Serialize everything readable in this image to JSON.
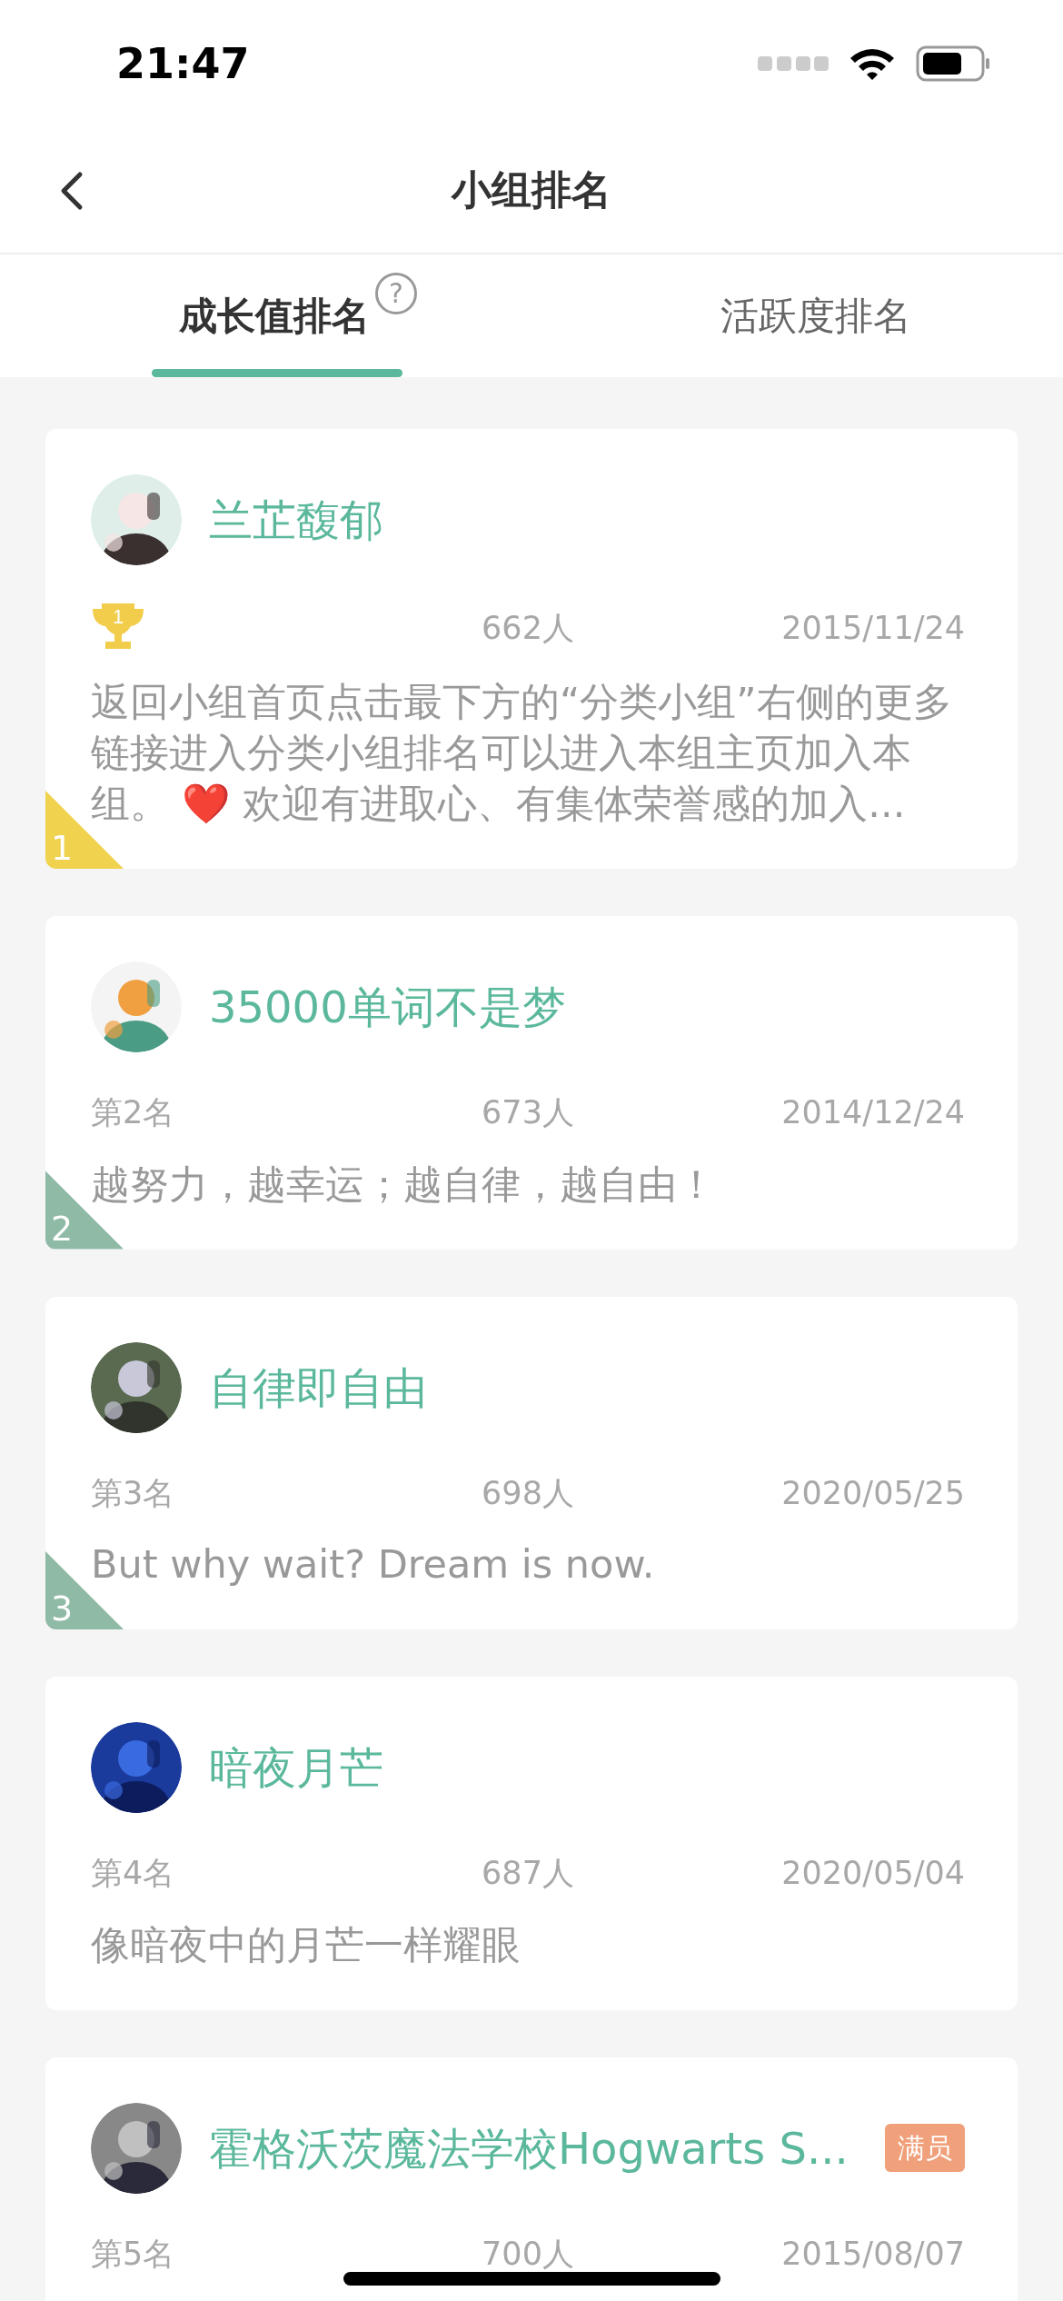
{
  "status_bar": {
    "time": "21:47"
  },
  "nav": {
    "title": "小组排名"
  },
  "tabs": [
    {
      "label": "成长值排名",
      "selected": true,
      "help": "?"
    },
    {
      "label": "活跃度排名",
      "selected": false
    }
  ],
  "groups": [
    {
      "name": "兰芷馥郁",
      "trophy": "1",
      "members": "662人",
      "date": "2015/11/24",
      "description": "返回小组首页点击最下方的“分类小组”右侧的更多链接进入分类小组排名可以进入本组主页加入本组。 ❤️ 欢迎有进取心、有集体荣誉感的加入...",
      "corner": "1",
      "color": "#f0d24f"
    },
    {
      "name": "35000单词不是梦",
      "rank": "第2名",
      "members": "673人",
      "date": "2014/12/24",
      "description": "越努力，越幸运；越自律，越自由！",
      "corner": "2",
      "color": "#8fbaa6"
    },
    {
      "name": "自律即自由",
      "rank": "第3名",
      "members": "698人",
      "date": "2020/05/25",
      "description": "But why wait?  Dream is now.",
      "corner": "3",
      "color": "#8fbaa6"
    },
    {
      "name": "暗夜月芒",
      "rank": "第4名",
      "members": "687人",
      "date": "2020/05/04",
      "description": "像暗夜中的月芒一样耀眼"
    },
    {
      "name": "霍格沃茨魔法学校Hogwarts S...",
      "badge": "满员",
      "rank": "第5名",
      "members": "700人",
      "date": "2015/08/07"
    }
  ]
}
